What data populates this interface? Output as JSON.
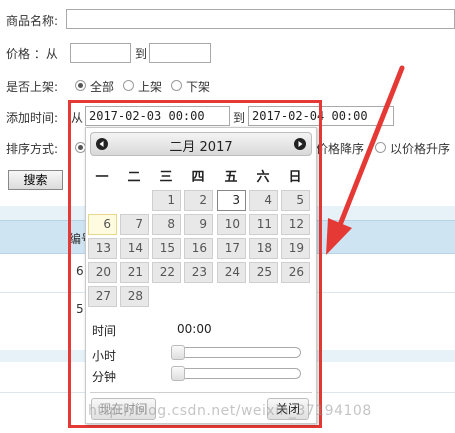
{
  "form": {
    "product_name_label": "商品名称:",
    "price_label": "价格  ：从",
    "price_to": "到",
    "listed_label": "是否上架:",
    "listed_options": [
      "全部",
      "上架",
      "下架"
    ],
    "added_time_label": "添加时间:",
    "added_from": "从",
    "added_to": "到",
    "date_from_value": "2017-02-03 00:00",
    "date_to_value": "2017-02-04 00:00",
    "sort_label": "排序方式:",
    "sort_options": [
      "价格降序",
      "以价格升序"
    ],
    "search_button": "搜索"
  },
  "table": {
    "header_fragment": "编号",
    "row_fragments": [
      "6",
      "5"
    ]
  },
  "calendar": {
    "title": "二月 2017",
    "weekdays": [
      "一",
      "二",
      "三",
      "四",
      "五",
      "六",
      "日"
    ],
    "days": [
      "1",
      "2",
      "3",
      "4",
      "5",
      "6",
      "7",
      "8",
      "9",
      "10",
      "11",
      "12",
      "13",
      "14",
      "15",
      "16",
      "17",
      "18",
      "19",
      "20",
      "21",
      "22",
      "23",
      "24",
      "25",
      "26",
      "27",
      "28"
    ],
    "today": "6",
    "selected": "3",
    "time_label": "时间",
    "time_value": "00:00",
    "hour_label": "小时",
    "minute_label": "分钟",
    "now_button": "现在时间",
    "close_button": "关闭"
  },
  "watermark": "http://blog.csdn.net/weixin_37194108",
  "colors": {
    "highlight": "#e53935",
    "table_band": "#cfe4f2"
  }
}
